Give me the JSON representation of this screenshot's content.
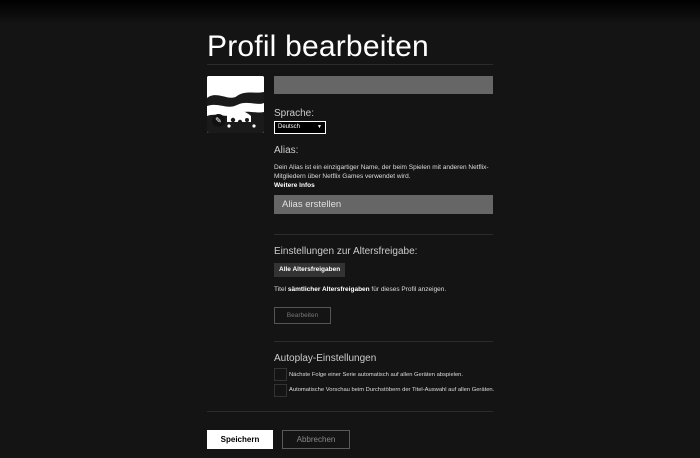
{
  "page": {
    "title": "Profil bearbeiten"
  },
  "profile": {
    "name_value": ""
  },
  "language": {
    "label": "Sprache:",
    "selected": "Deutsch"
  },
  "alias": {
    "label": "Alias:",
    "description": "Dein Alias ist ein einzigartiger Name, der beim Spielen mit anderen Netflix-Mitgliedern über Netflix Games verwendet wird.",
    "more_info": "Weitere Infos",
    "placeholder": "Alias erstellen"
  },
  "maturity": {
    "label": "Einstellungen zur Altersfreigabe:",
    "badge": "Alle Altersfreigaben",
    "text_prefix": "Titel ",
    "text_bold": "sämtlicher Altersfreigaben",
    "text_suffix": " für dieses Profil anzeigen.",
    "edit_button": "Bearbeiten"
  },
  "autoplay": {
    "label": "Autoplay-Einstellungen",
    "next_episode": "Nächste Folge einer Serie automatisch auf allen Geräten abspielen.",
    "previews": "Automatische Vorschau beim Durchstöbern der Titel-Auswahl auf allen Geräten."
  },
  "actions": {
    "save": "Speichern",
    "cancel": "Abbrechen"
  },
  "colors": {
    "background": "#141414",
    "input": "#666666",
    "primary_button": "#ffffff"
  }
}
